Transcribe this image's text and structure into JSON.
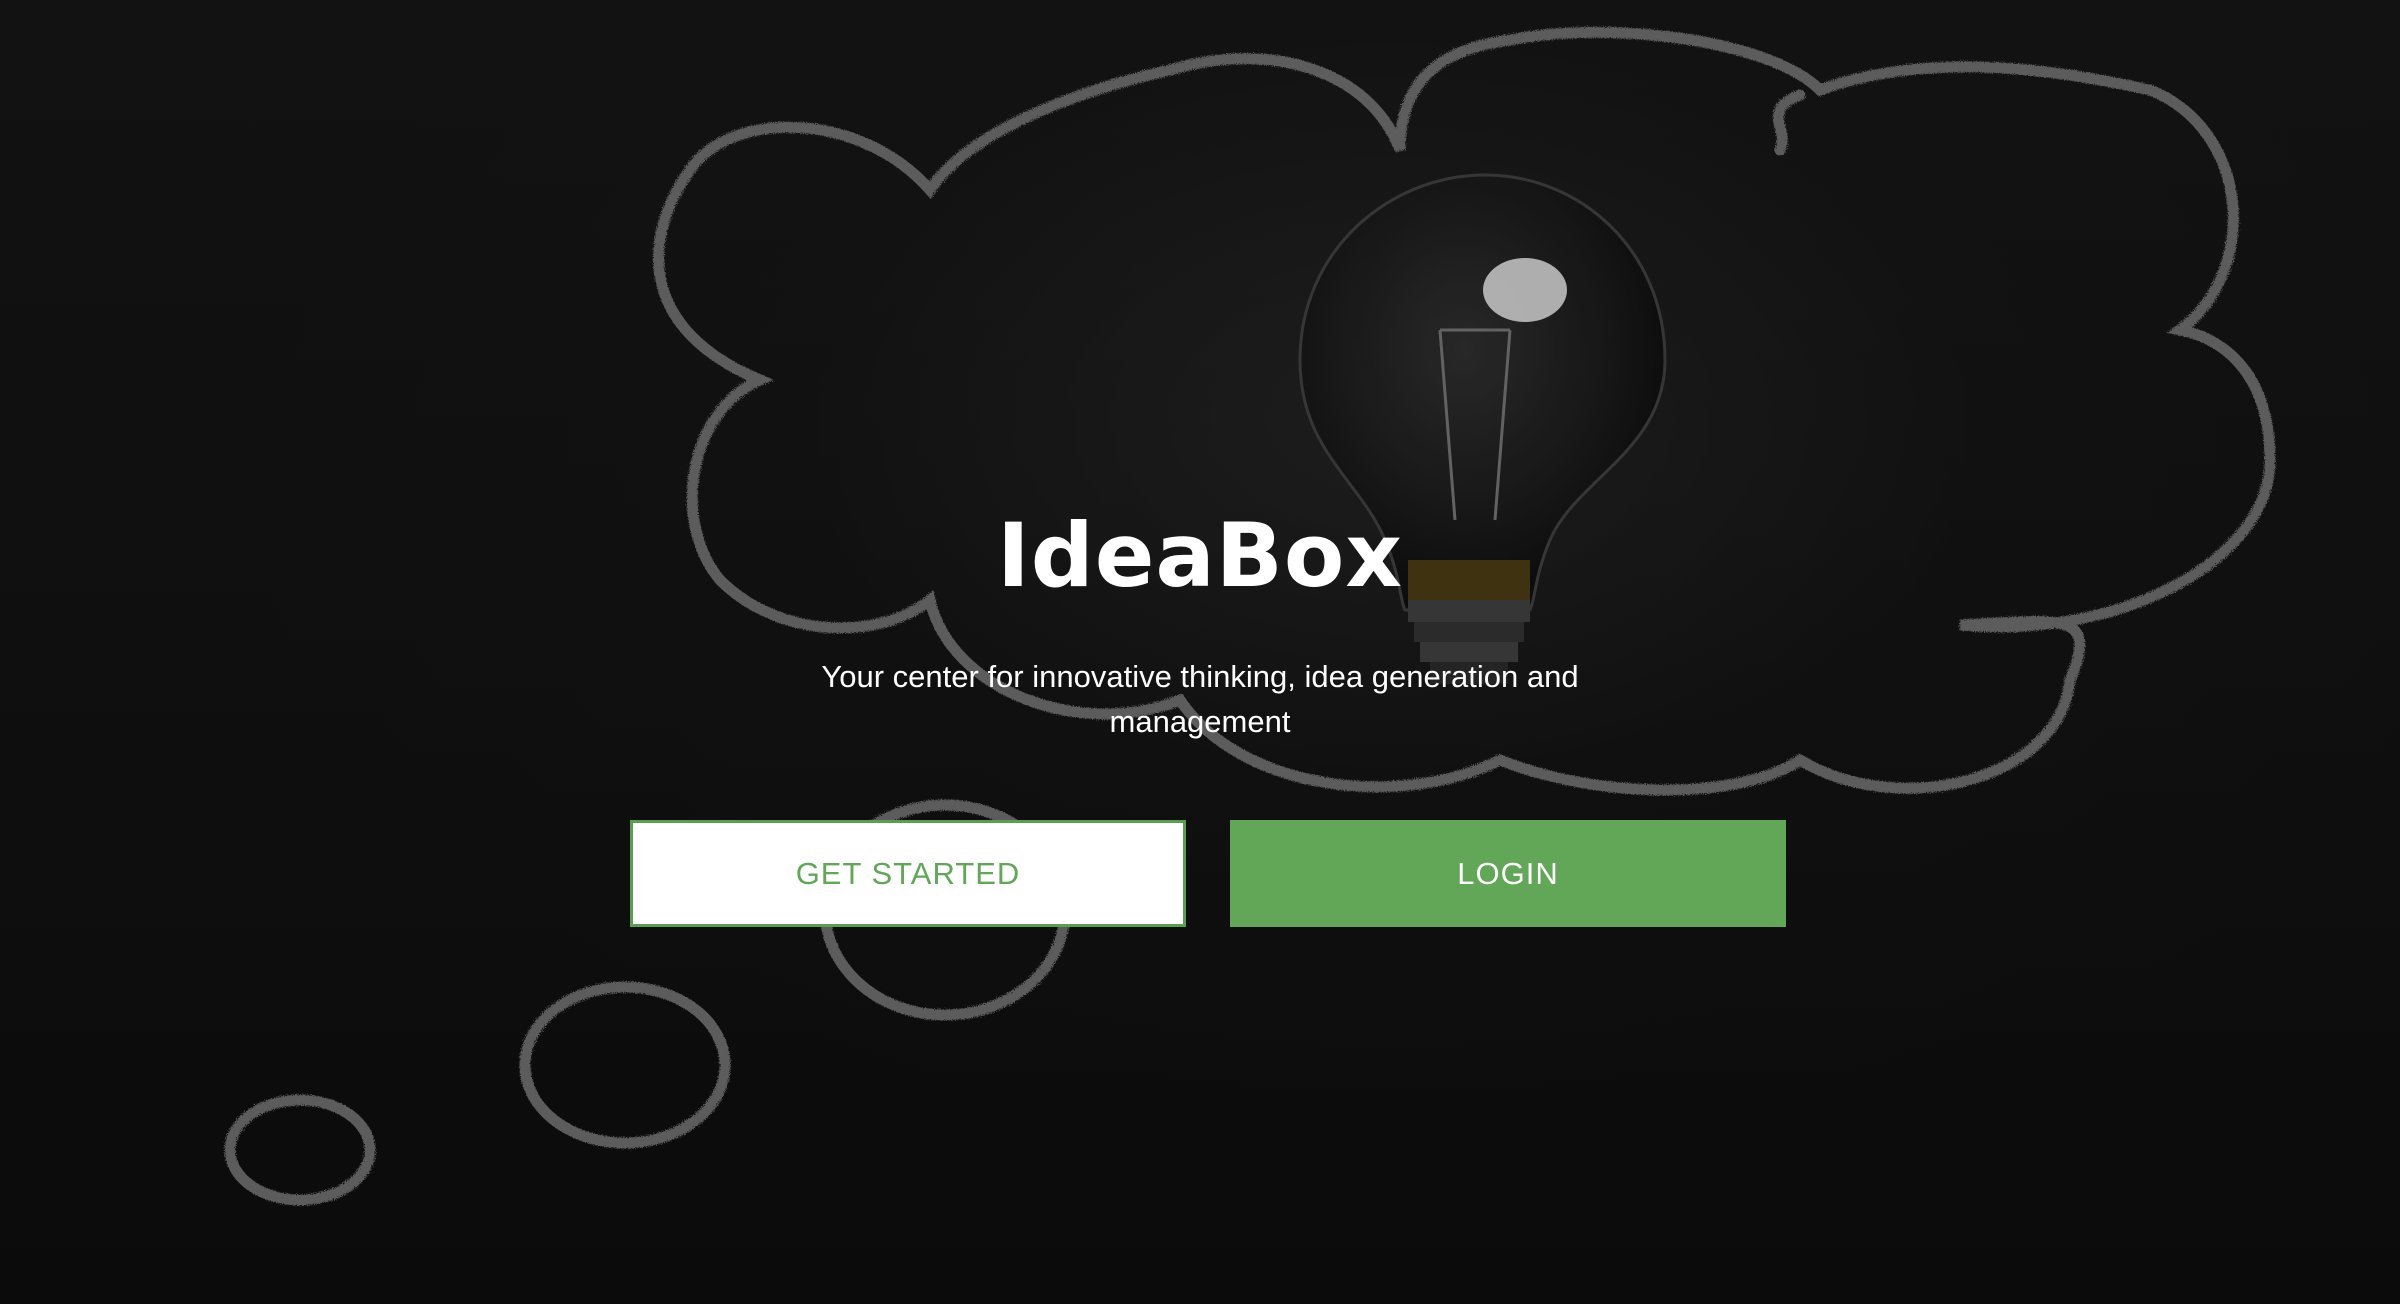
{
  "app": {
    "logo_text": "IdeaBox",
    "tagline_line1": "Your center for innovative thinking, idea generation and",
    "tagline_line2": "management"
  },
  "actions": {
    "get_started_label": "GET STARTED",
    "login_label": "LOGIN"
  },
  "colors": {
    "accent": "#62a758",
    "background": "#0d0d0d",
    "text": "#ffffff"
  },
  "background_image": {
    "icon": "lightbulb-icon",
    "chalk_drawing": "thought-bubble"
  }
}
